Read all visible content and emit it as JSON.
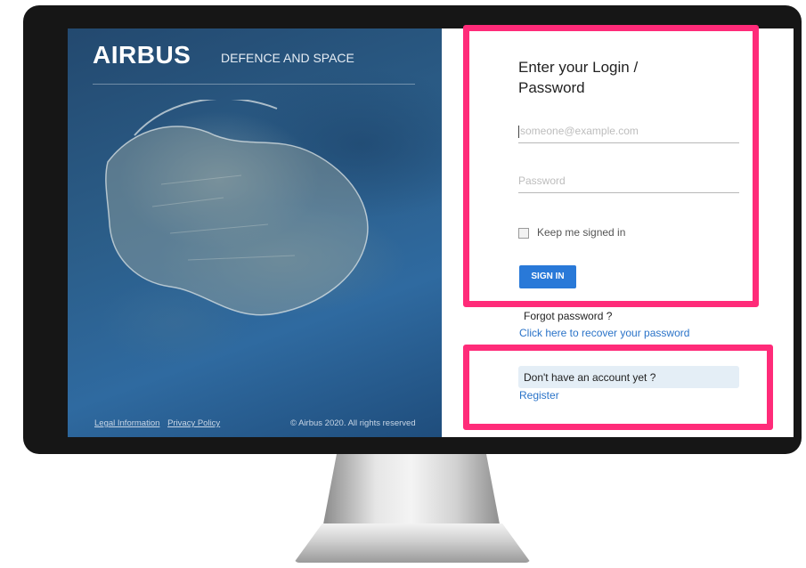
{
  "hero": {
    "logo": "AIRBUS",
    "tagline": "DEFENCE AND SPACE",
    "legal_link": "Legal Information",
    "privacy_link": "Privacy Policy",
    "copyright": "© Airbus 2020. All rights reserved"
  },
  "login": {
    "heading_line1": "Enter your Login /",
    "heading_line2": "Password",
    "email_placeholder": "someone@example.com",
    "password_placeholder": "Password",
    "keep_signed_in": "Keep me signed in",
    "sign_in_button": "SIGN IN",
    "forgot": "Forgot password ?",
    "recover_link": "Click here to recover your password"
  },
  "register": {
    "prompt": "Don't have an account yet ?",
    "link": "Register"
  },
  "colors": {
    "highlight": "#ff2b79",
    "button": "#2979d8",
    "link": "#2a73c8",
    "account_box": "#e4eef6"
  }
}
